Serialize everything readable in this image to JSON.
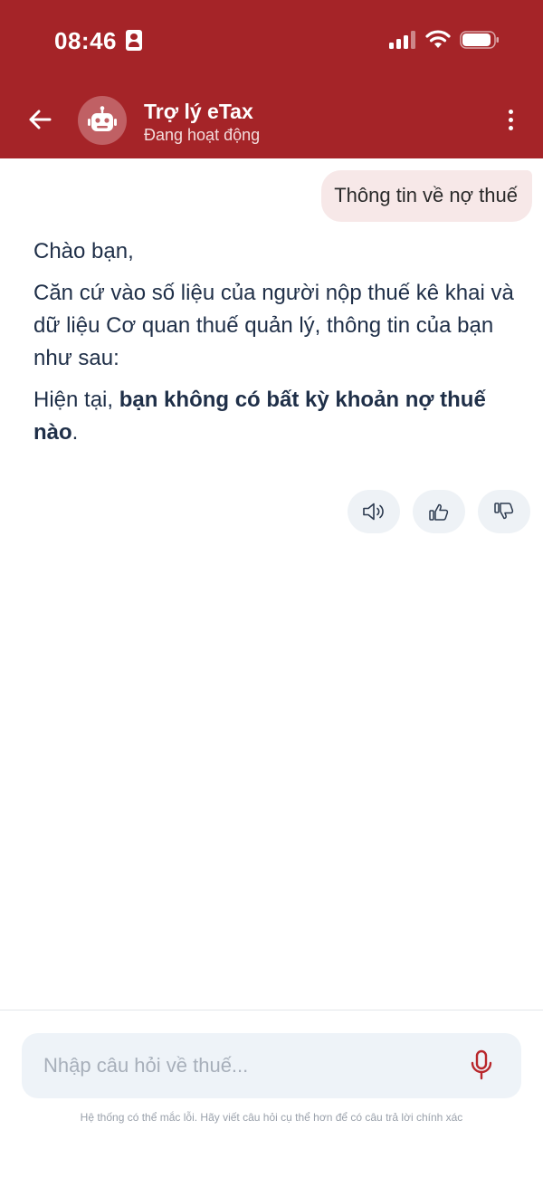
{
  "status_bar": {
    "time": "08:46"
  },
  "header": {
    "title": "Trợ lý eTax",
    "status": "Đang hoạt động",
    "accent_color": "#a52428"
  },
  "conversation": {
    "user_message": "Thông tin về nợ thuế",
    "bot_greeting": "Chào bạn,",
    "bot_intro": "Căn cứ vào số liệu của người nộp thuế kê khai và dữ liệu Cơ quan thuế quản lý, thông tin của bạn như sau:",
    "bot_result_prefix": "Hiện tại, ",
    "bot_result_bold": "bạn không có bất kỳ khoản nợ thuế nào",
    "bot_result_suffix": "."
  },
  "actions": {
    "icons": [
      "speaker-icon",
      "thumbs-up-icon",
      "thumbs-down-icon"
    ]
  },
  "composer": {
    "placeholder": "Nhập câu hỏi về thuế...",
    "value": "",
    "disclaimer": "Hệ thống có thể mắc lỗi. Hãy viết câu hỏi cụ thể hơn để có câu trả lời chính xác"
  }
}
